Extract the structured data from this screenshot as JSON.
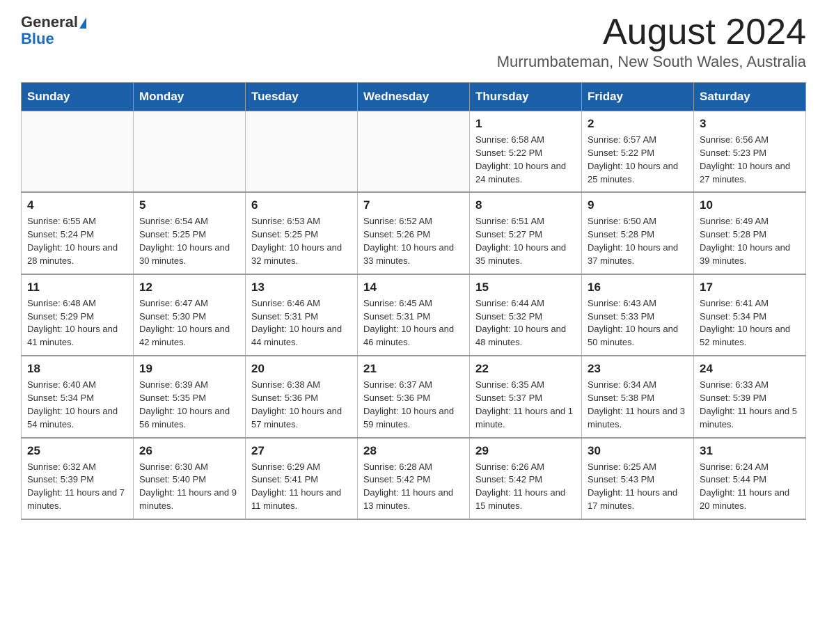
{
  "header": {
    "logo_general": "General",
    "logo_blue": "Blue",
    "month_title": "August 2024",
    "location": "Murrumbateman, New South Wales, Australia"
  },
  "weekdays": [
    "Sunday",
    "Monday",
    "Tuesday",
    "Wednesday",
    "Thursday",
    "Friday",
    "Saturday"
  ],
  "weeks": [
    [
      {
        "day": "",
        "info": ""
      },
      {
        "day": "",
        "info": ""
      },
      {
        "day": "",
        "info": ""
      },
      {
        "day": "",
        "info": ""
      },
      {
        "day": "1",
        "info": "Sunrise: 6:58 AM\nSunset: 5:22 PM\nDaylight: 10 hours and 24 minutes."
      },
      {
        "day": "2",
        "info": "Sunrise: 6:57 AM\nSunset: 5:22 PM\nDaylight: 10 hours and 25 minutes."
      },
      {
        "day": "3",
        "info": "Sunrise: 6:56 AM\nSunset: 5:23 PM\nDaylight: 10 hours and 27 minutes."
      }
    ],
    [
      {
        "day": "4",
        "info": "Sunrise: 6:55 AM\nSunset: 5:24 PM\nDaylight: 10 hours and 28 minutes."
      },
      {
        "day": "5",
        "info": "Sunrise: 6:54 AM\nSunset: 5:25 PM\nDaylight: 10 hours and 30 minutes."
      },
      {
        "day": "6",
        "info": "Sunrise: 6:53 AM\nSunset: 5:25 PM\nDaylight: 10 hours and 32 minutes."
      },
      {
        "day": "7",
        "info": "Sunrise: 6:52 AM\nSunset: 5:26 PM\nDaylight: 10 hours and 33 minutes."
      },
      {
        "day": "8",
        "info": "Sunrise: 6:51 AM\nSunset: 5:27 PM\nDaylight: 10 hours and 35 minutes."
      },
      {
        "day": "9",
        "info": "Sunrise: 6:50 AM\nSunset: 5:28 PM\nDaylight: 10 hours and 37 minutes."
      },
      {
        "day": "10",
        "info": "Sunrise: 6:49 AM\nSunset: 5:28 PM\nDaylight: 10 hours and 39 minutes."
      }
    ],
    [
      {
        "day": "11",
        "info": "Sunrise: 6:48 AM\nSunset: 5:29 PM\nDaylight: 10 hours and 41 minutes."
      },
      {
        "day": "12",
        "info": "Sunrise: 6:47 AM\nSunset: 5:30 PM\nDaylight: 10 hours and 42 minutes."
      },
      {
        "day": "13",
        "info": "Sunrise: 6:46 AM\nSunset: 5:31 PM\nDaylight: 10 hours and 44 minutes."
      },
      {
        "day": "14",
        "info": "Sunrise: 6:45 AM\nSunset: 5:31 PM\nDaylight: 10 hours and 46 minutes."
      },
      {
        "day": "15",
        "info": "Sunrise: 6:44 AM\nSunset: 5:32 PM\nDaylight: 10 hours and 48 minutes."
      },
      {
        "day": "16",
        "info": "Sunrise: 6:43 AM\nSunset: 5:33 PM\nDaylight: 10 hours and 50 minutes."
      },
      {
        "day": "17",
        "info": "Sunrise: 6:41 AM\nSunset: 5:34 PM\nDaylight: 10 hours and 52 minutes."
      }
    ],
    [
      {
        "day": "18",
        "info": "Sunrise: 6:40 AM\nSunset: 5:34 PM\nDaylight: 10 hours and 54 minutes."
      },
      {
        "day": "19",
        "info": "Sunrise: 6:39 AM\nSunset: 5:35 PM\nDaylight: 10 hours and 56 minutes."
      },
      {
        "day": "20",
        "info": "Sunrise: 6:38 AM\nSunset: 5:36 PM\nDaylight: 10 hours and 57 minutes."
      },
      {
        "day": "21",
        "info": "Sunrise: 6:37 AM\nSunset: 5:36 PM\nDaylight: 10 hours and 59 minutes."
      },
      {
        "day": "22",
        "info": "Sunrise: 6:35 AM\nSunset: 5:37 PM\nDaylight: 11 hours and 1 minute."
      },
      {
        "day": "23",
        "info": "Sunrise: 6:34 AM\nSunset: 5:38 PM\nDaylight: 11 hours and 3 minutes."
      },
      {
        "day": "24",
        "info": "Sunrise: 6:33 AM\nSunset: 5:39 PM\nDaylight: 11 hours and 5 minutes."
      }
    ],
    [
      {
        "day": "25",
        "info": "Sunrise: 6:32 AM\nSunset: 5:39 PM\nDaylight: 11 hours and 7 minutes."
      },
      {
        "day": "26",
        "info": "Sunrise: 6:30 AM\nSunset: 5:40 PM\nDaylight: 11 hours and 9 minutes."
      },
      {
        "day": "27",
        "info": "Sunrise: 6:29 AM\nSunset: 5:41 PM\nDaylight: 11 hours and 11 minutes."
      },
      {
        "day": "28",
        "info": "Sunrise: 6:28 AM\nSunset: 5:42 PM\nDaylight: 11 hours and 13 minutes."
      },
      {
        "day": "29",
        "info": "Sunrise: 6:26 AM\nSunset: 5:42 PM\nDaylight: 11 hours and 15 minutes."
      },
      {
        "day": "30",
        "info": "Sunrise: 6:25 AM\nSunset: 5:43 PM\nDaylight: 11 hours and 17 minutes."
      },
      {
        "day": "31",
        "info": "Sunrise: 6:24 AM\nSunset: 5:44 PM\nDaylight: 11 hours and 20 minutes."
      }
    ]
  ]
}
